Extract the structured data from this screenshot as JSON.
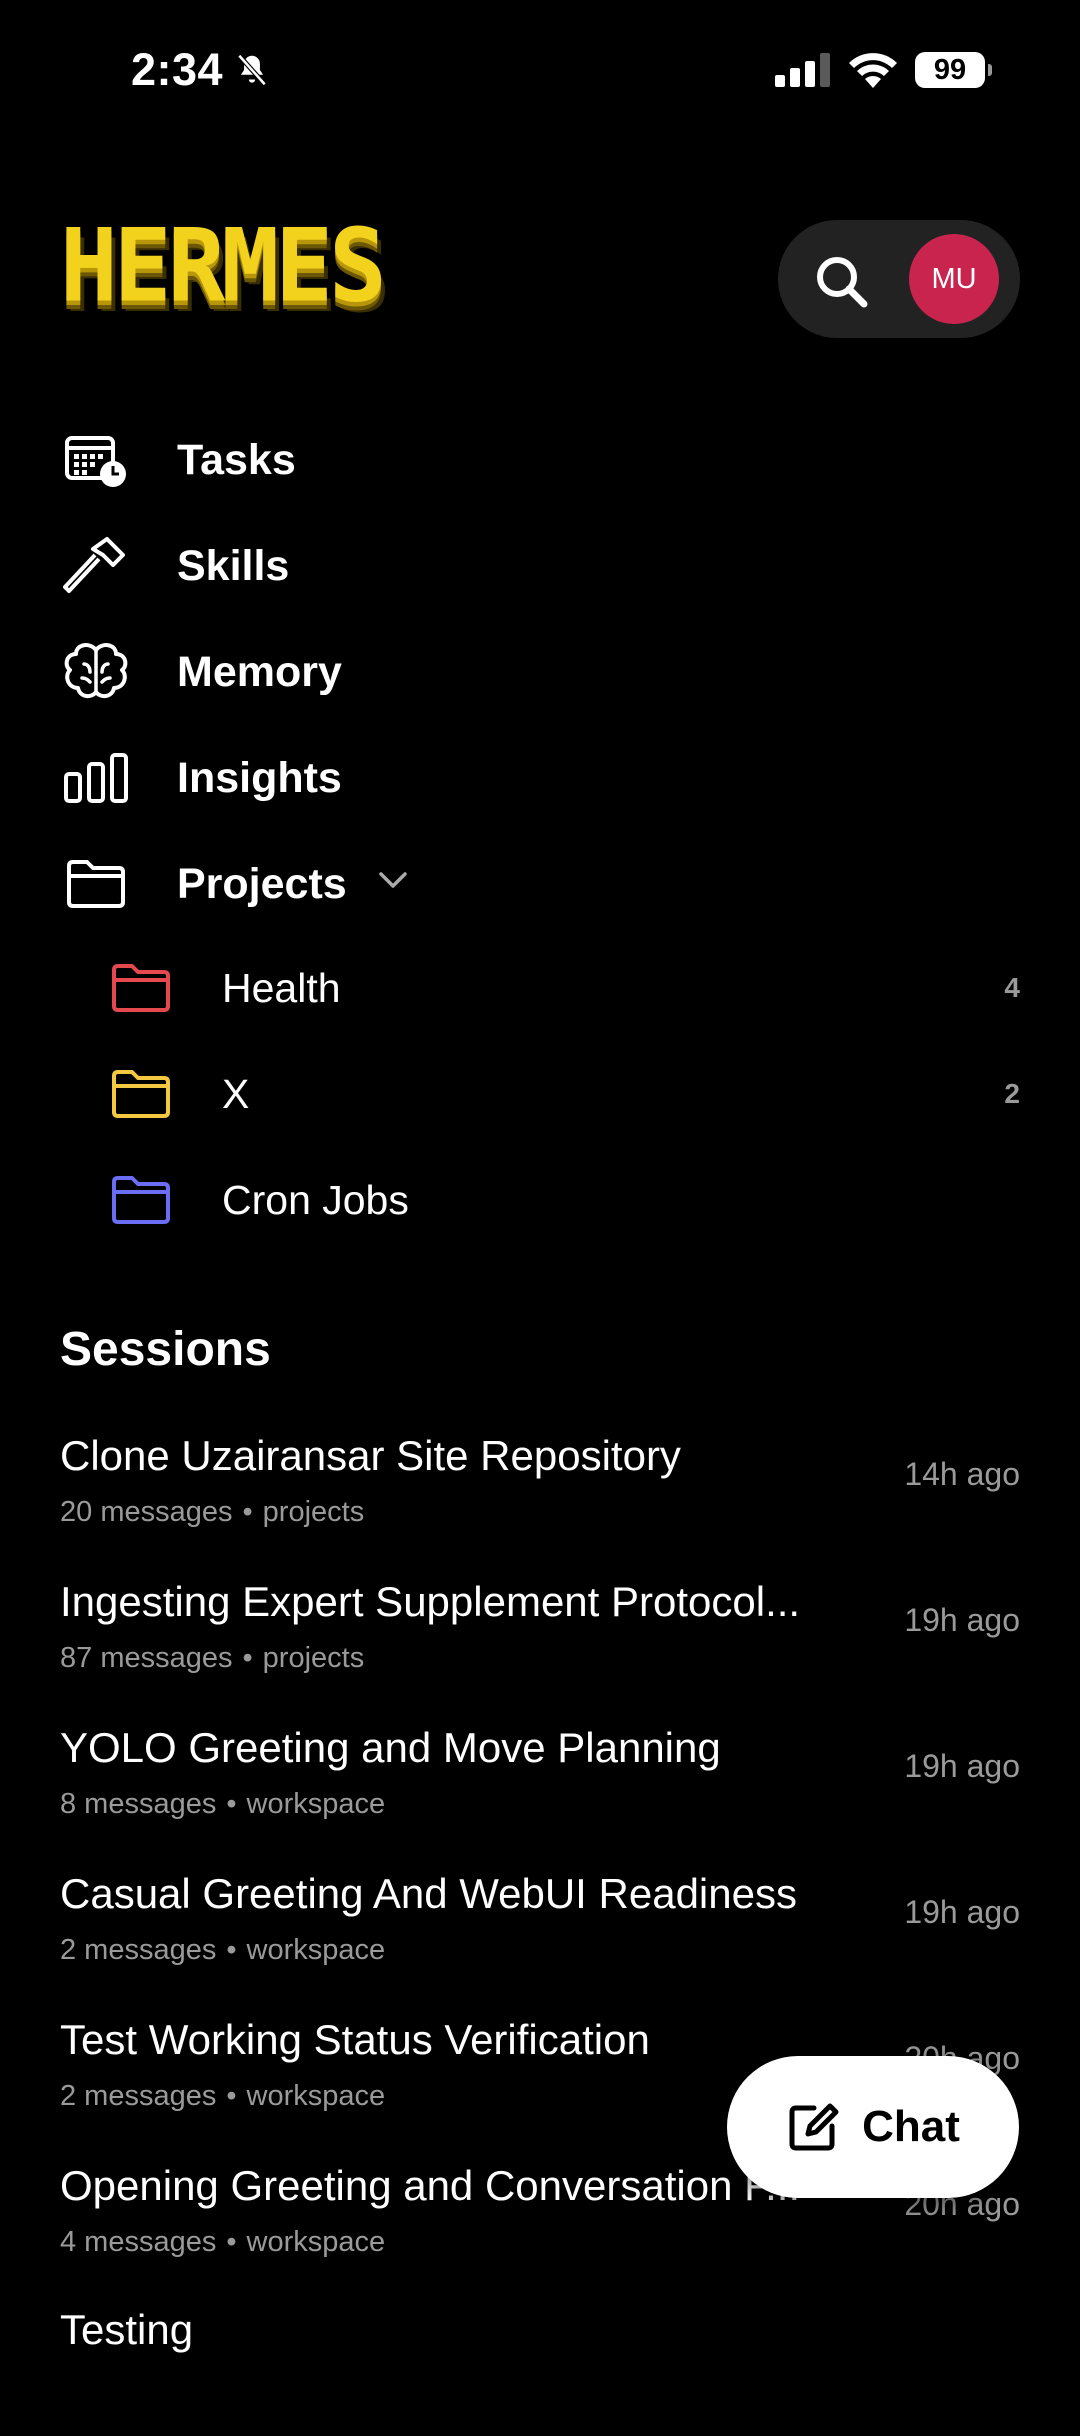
{
  "status_bar": {
    "time": "2:34",
    "battery": "99",
    "icons": [
      "bell-slash-icon",
      "signal-icon",
      "wifi-icon",
      "battery-icon"
    ]
  },
  "header": {
    "logo_text": "HERMES",
    "search_icon": "search-icon",
    "avatar_initials": "MU",
    "avatar_color": "#c8244e",
    "logo_color": "#f2d21c"
  },
  "nav": {
    "items": [
      {
        "label": "Tasks",
        "icon": "calendar-clock-icon"
      },
      {
        "label": "Skills",
        "icon": "hammer-icon"
      },
      {
        "label": "Memory",
        "icon": "brain-icon"
      },
      {
        "label": "Insights",
        "icon": "bar-chart-icon"
      },
      {
        "label": "Projects",
        "icon": "folder-icon",
        "expanded": true
      }
    ]
  },
  "projects": [
    {
      "name": "Health",
      "count": "4",
      "color": "#e5484d"
    },
    {
      "name": "X",
      "count": "2",
      "color": "#f5c842"
    },
    {
      "name": "Cron Jobs",
      "count": "",
      "color": "#6b6ef5"
    }
  ],
  "sessions": {
    "title": "Sessions",
    "separator": "•",
    "items": [
      {
        "title": "Clone Uzairansar Site Repository",
        "messages": "20 messages",
        "scope": "projects",
        "time": "14h ago"
      },
      {
        "title": "Ingesting Expert Supplement Protocol...",
        "messages": "87 messages",
        "scope": "projects",
        "time": "19h ago"
      },
      {
        "title": "YOLO Greeting and Move Planning",
        "messages": "8 messages",
        "scope": "workspace",
        "time": "19h ago"
      },
      {
        "title": "Casual Greeting And WebUI Readiness",
        "messages": "2 messages",
        "scope": "workspace",
        "time": "19h ago"
      },
      {
        "title": "Test Working Status Verification",
        "messages": "2 messages",
        "scope": "workspace",
        "time": "20h ago"
      },
      {
        "title": "Opening Greeting and Conversation F...",
        "messages": "4 messages",
        "scope": "workspace",
        "time": "20h ago"
      },
      {
        "title": "Testing",
        "messages": "",
        "scope": "",
        "time": ""
      }
    ]
  },
  "chat_button": {
    "label": "Chat",
    "icon": "compose-icon"
  }
}
